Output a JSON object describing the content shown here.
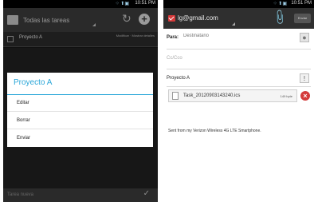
{
  "left_phone": {
    "status_time": "10:51 PM",
    "status_icons": "⁘ ⬆▣",
    "header": {
      "list_title": "Todas las tareas",
      "sync_icon": "↻",
      "add_icon": "+"
    },
    "task": {
      "name": "Proyecto A",
      "meta": "Modificar · Mostrar detalles"
    },
    "dialog": {
      "title": "Proyecto A",
      "items": [
        "Editar",
        "Borrar",
        "Enviar"
      ]
    },
    "footer": {
      "new_task_placeholder": "Tarea nueva",
      "confirm_icon": "✓"
    }
  },
  "right_phone": {
    "status_time": "10:51 PM",
    "status_icons": "⁘ ⬆▣",
    "header": {
      "account": "lg@gmail.com",
      "attach_icon": "✂",
      "send_label": "Enviar"
    },
    "to_label": "Para:",
    "to_placeholder": "Destinatario",
    "cc_placeholder": "Cc/Cco",
    "subject": "Proyecto A",
    "priority_icon": "!",
    "attachment": {
      "name": "Task_20120903143240.ics",
      "size": "149 byte"
    },
    "remove_icon": "×",
    "signature": "Sent from my Verizon Wireless 4G LTE Smartphone."
  },
  "colors": {
    "accent_blue": "#2aa6d8",
    "remove_red": "#d43b3b",
    "dark_bar": "#2a2a2a"
  }
}
